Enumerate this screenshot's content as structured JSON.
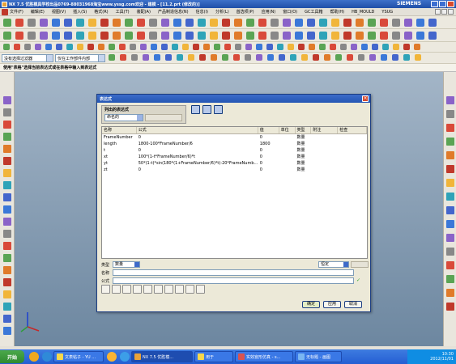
{
  "window": {
    "title": "NX 7.5 优胜模具学校出品0769-88031968淘宝www.yssg.com欢迎 - 建模 - [11.2.prt (修改的)]",
    "brand": "SIEMENS"
  },
  "menu": [
    "文件(F)",
    "编辑(E)",
    "视图(V)",
    "插入(S)",
    "格式(R)",
    "工具(T)",
    "装配(A)",
    "产品制造信息(N)",
    "信息(I)",
    "分析(L)",
    "首选项(P)",
    "应用(N)",
    "窗口(O)",
    "GC工具箱",
    "帮助(H)",
    "HB_MOULD",
    "YSUG"
  ],
  "selection_bar": {
    "filter": "没有选择过滤器",
    "scope": "仅在工作部件内部"
  },
  "cue_line": "使用\"表格\"选择当前表达式或在表格中输入到表达式",
  "dialog": {
    "title": "表达式",
    "list_group_label": "列出的表达式",
    "list_select": "命名的",
    "columns": [
      "名称",
      "公式",
      "值",
      "单位",
      "类型",
      "附注",
      "检查"
    ],
    "rows": [
      [
        "FrameNumber",
        "0",
        "0",
        "",
        "数量",
        "",
        ""
      ],
      [
        "length",
        "1800-100*FrameNumber/6",
        "1800",
        "",
        "数量",
        "",
        ""
      ],
      [
        "t",
        "0",
        "0",
        "",
        "数量",
        "",
        ""
      ],
      [
        "xt",
        "100*(1-t*FrameNumber/6)*t",
        "0",
        "",
        "数量",
        "",
        ""
      ],
      [
        "yt",
        "50*(1-t)*sin(180*(1+FrameNumber/6)*t)-20*FrameNumb...",
        "0",
        "",
        "数量",
        "",
        ""
      ],
      [
        "zt",
        "0",
        "0",
        "",
        "数量",
        "",
        ""
      ]
    ],
    "type_label": "类型",
    "type_value": "数量",
    "unit_value": "恒定",
    "name_label": "名称",
    "formula_label": "公式",
    "buttons": {
      "ok": "确定",
      "apply": "应用",
      "cancel": "取消"
    }
  },
  "taskbar": {
    "start": "开始",
    "tasks": [
      "文表帖子 - YU ...",
      "NX 7.5 优胜模...",
      "用于",
      "实效宫形仿真 - s...",
      "无标题 - 画图"
    ],
    "time": "10:30",
    "date": "2012/11/01"
  },
  "colors": {
    "title_blue": "#2456b4",
    "graphics_top": "#a3b5c7",
    "graphics_bottom": "#6d87a0",
    "taskbar_blue": "#245ed3",
    "start_green": "#2f8a2f"
  }
}
